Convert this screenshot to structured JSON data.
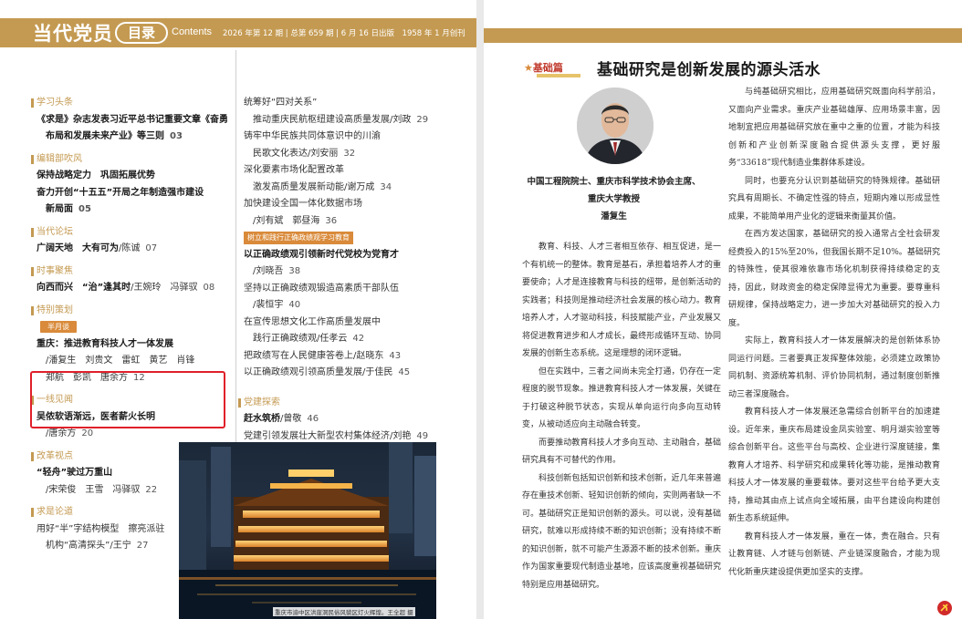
{
  "masthead": {
    "title": "当代党员",
    "mu_label": "目录",
    "contents": "Contents",
    "issue_info": "2026 年第 12 期 | 总第 659 期 | 6 月 16 日出版　1958 年 1 月创刊"
  },
  "toc_left": {
    "s1": {
      "name": "学习头条",
      "l1": "《求是》杂志发表习近平总书记重要文章《奋勇",
      "l2": "布局和发展未来产业》等三则",
      "p": "03"
    },
    "s2": {
      "name": "编辑部吹风",
      "l1": "保持战略定力　巩固拓展优势",
      "l2": "奋力开创“十五五”开局之年制造强市建设",
      "l3": "新局面",
      "p": "05"
    },
    "s3": {
      "name": "当代论坛",
      "l1": "广阔天地　大有可为",
      "a1": "/陈诚",
      "p": "07"
    },
    "s4": {
      "name": "时事聚焦",
      "l1": "向西而兴　“治”逢其时",
      "a1": "/王婉玲　冯驿驭",
      "p": "08"
    },
    "s5": {
      "name": "特别策划",
      "badge": "半月谈",
      "l1": "重庆：推进教育科技人才一体发展",
      "a1": "/潘复生　刘贵文　雷虹　黄艺　肖锋",
      "a2": "郑航　彭凯　唐余方",
      "p": "12"
    },
    "s6": {
      "name": "一线见闻",
      "l1": "吴侬软语渐远，医者薪火长明",
      "a1": "/唐余方",
      "p": "20"
    },
    "s7": {
      "name": "改革视点",
      "l1": "“轻舟”驶过万重山",
      "a1": "/宋荣俊　王雪　冯驿驭",
      "p": "22"
    },
    "s8": {
      "name": "求是论道",
      "l1": "用好“半”字结构模型　擦亮派驻",
      "l2": "机构“高清探头”",
      "a1": "/王宁",
      "p": "27"
    }
  },
  "toc_right": {
    "r1": "统筹好“四对关系”",
    "r2": "推动重庆民航枢纽建设高质量发展/刘政",
    "r2p": "29",
    "r3": "铸牢中华民族共同体意识中的川渝",
    "r4": "民歌文化表达/刘安丽",
    "r4p": "32",
    "r5": "深化要素市场化配置改革",
    "r6": "激发高质量发展新动能/谢万成",
    "r6p": "34",
    "r7": "加快建设全国一体化数据市场",
    "r8": "/刘有斌　郭昼海",
    "r8p": "36",
    "badge": "树立和践行正确政绩观学习教育",
    "r9": "以正确政绩观引领新时代党校为党育才",
    "r10": "/刘晓吾",
    "r10p": "38",
    "r11": "坚持以正确政绩观锻造高素质干部队伍",
    "r12": "/裴恒宇",
    "r12p": "40",
    "r13": "在宣传思想文化工作高质量发展中",
    "r14": "践行正确政绩观/任孝云",
    "r14p": "42",
    "r15": "把政绩写在人民健康答卷上/赵晓东",
    "r15p": "43",
    "r16": "以正确政绩观引领高质量发展/于佳民",
    "r16p": "45",
    "sec": "党建探索",
    "r17": "赶水筑桥",
    "r17a": "/曾敬",
    "r17p": "46",
    "r18": "党建引领发展壮大新型农村集体经济/刘艳",
    "r18p": "49"
  },
  "photo_caption": "重庆市渝中区洪崖洞民俗风貌区灯火辉煌。王全超 摄",
  "article": {
    "column_tag": "基础篇",
    "title": "基础研究是创新发展的源头活水",
    "author_line1": "中国工程院院士、重庆市科学技术协会主席、",
    "author_line2": "重庆大学教授",
    "author_name": "潘复生",
    "left_paras": [
      "教育、科技、人才三者相互依存、相互促进，是一个有机统一的整体。教育是基石，承担着培养人才的重要使命；人才是连接教育与科技的纽带，是创新活动的实践者；科技则是推动经济社会发展的核心动力。教育培养人才，人才驱动科技，科技赋能产业，产业发展又将促进教育进步和人才成长，最终形成循环互动、协同发展的创新生态系统。这是理想的闭环逻辑。",
      "但在实践中，三者之间尚未完全打通，仍存在一定程度的脱节现象。推进教育科技人才一体发展，关键在于打破这种脱节状态，实现从单向运行向多向互动转变，从被动适应向主动融合转变。",
      "而要推动教育科技人才多向互动、主动融合，基础研究具有不可替代的作用。",
      "科技创新包括知识创新和技术创新，近几年来普遍存在重技术创新、轻知识创新的倾向，实则两者缺一不可。基础研究正是知识创新的源头。可以说，没有基础研究，就难以形成持续不断的知识创新；没有持续不断的知识创新，就不可能产生源源不断的技术创新。重庆作为国家重要现代制造业基地，应该高度重视基础研究特别是应用基础研究。"
    ],
    "right_paras": [
      "与纯基础研究相比，应用基础研究既面向科学前沿，又面向产业需求。重庆产业基础雄厚、应用场景丰富，因地制宜把应用基础研究放在重中之重的位置，才能为科技创新和产业创新深度融合提供源头支撑，更好服务“33618”现代制造业集群体系建设。",
      "同时，也要充分认识到基础研究的特殊规律。基础研究具有周期长、不确定性强的特点，短期内难以形成显性成果，不能简单用产业化的逻辑来衡量其价值。",
      "在西方发达国家，基础研究的投入通常占全社会研发经费投入的15%至20%，但我国长期不足10%。基础研究的特殊性，使其很难依靠市场化机制获得持续稳定的支持，因此，财政资金的稳定保障显得尤为重要。要尊重科研规律，保持战略定力，进一步加大对基础研究的投入力度。",
      "实际上，教育科技人才一体发展解决的是创新体系协同运行问题。三者要真正发挥整体效能，必须建立政策协同机制、资源统筹机制、评价协同机制，通过制度创新推动三者深度融合。",
      "教育科技人才一体发展还急需综合创新平台的加速建设。近年来，重庆布局建设金凤实验室、明月湖实验室等综合创新平台。这些平台与高校、企业进行深度链接，集教育人才培养、科学研究和成果转化等功能，是推动教育科技人才一体发展的重要载体。要对这些平台给予更大支持，推动其由点上试点向全域拓展，由平台建设向构建创新生态系统延伸。",
      "教育科技人才一体发展，重在一体，贵在融合。只有让教育链、人才链与创新链、产业链深度融合，才能为现代化新重庆建设提供更加坚实的支撑。"
    ]
  },
  "colors": {
    "gold": "#c49a52",
    "orange": "#d98a3a",
    "red": "#e0202a",
    "tag_red": "#c0392b"
  }
}
